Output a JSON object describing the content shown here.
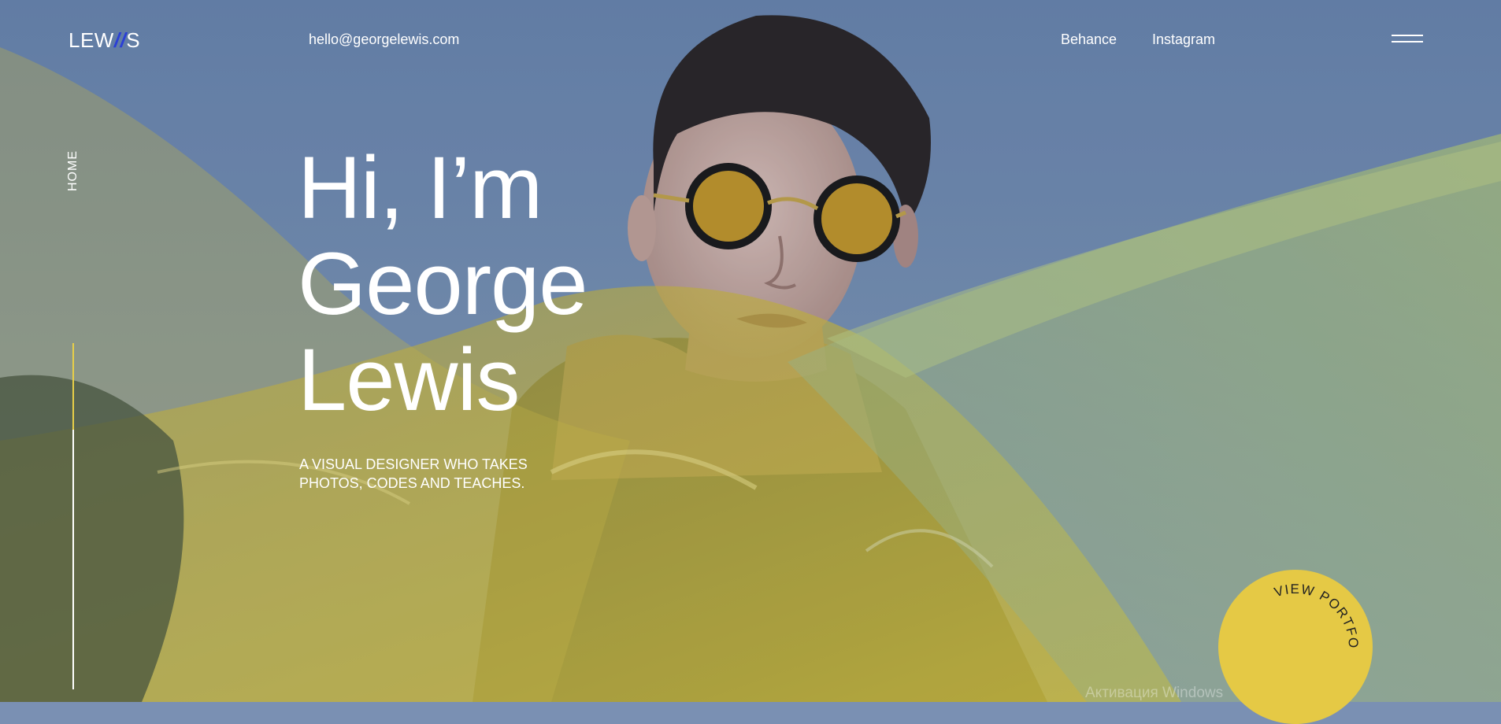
{
  "brand": {
    "logo_prefix": "LEW",
    "logo_slash": "//",
    "logo_suffix": "S"
  },
  "header": {
    "email": "hello@georgelewis.com",
    "links": [
      {
        "label": "Behance"
      },
      {
        "label": "Instagram"
      }
    ],
    "menu_icon": "hamburger-menu-icon"
  },
  "side_nav": {
    "label": "HOME",
    "scroll_progress": 0.25
  },
  "hero": {
    "title_lines": [
      "Hi, I’m",
      "George",
      "Lewis"
    ],
    "subtitle": "A VISUAL DESIGNER WHO TAKES PHOTOS, CODES AND TEACHES."
  },
  "cta": {
    "label": "VIEW PORTFOLIO"
  },
  "overlay": {
    "watermark": "Активация Windows"
  },
  "colors": {
    "accent_yellow": "#e5c945",
    "logo_slash": "#2a3fd6",
    "sky": "#7a90b3"
  }
}
